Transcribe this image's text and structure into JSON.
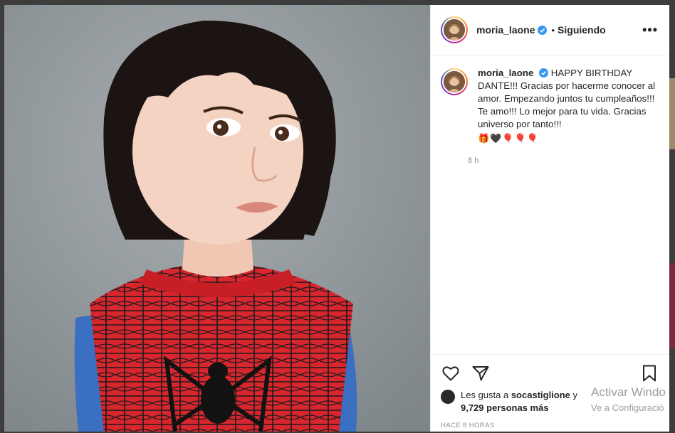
{
  "post": {
    "username": "moria_laone",
    "follow_status": "Siguiendo",
    "more_label": "•••",
    "caption": "HAPPY BIRTHDAY DANTE!!! Gracias por hacerme conocer al amor. Empezando juntos tu cumpleaños!!! Te amo!!! Lo mejor para tu vida. Gracias universo por tanto!!!",
    "caption_emoji": "🎁🖤🎈🎈🎈",
    "caption_time": "8 h",
    "likes_prefix": "Les gusta a ",
    "likes_user": "socastiglione",
    "likes_suffix": " y",
    "likes_count": "9,729 personas más",
    "posted_ago": "HACE 8 HORAS",
    "photo_icon": "photo-of-child-in-spiderman-shirt"
  },
  "icons": {
    "like": "heart-icon",
    "share": "share-icon",
    "save": "bookmark-icon",
    "verified": "verified-badge-icon"
  },
  "watermark": {
    "line1": "Activar Windo",
    "line2": "Ve a Configuració"
  },
  "colors": {
    "verified": "#3897f0",
    "secondary_text": "#8e8e8e",
    "shirt_red": "#d8262e",
    "shirt_blue": "#3a6fc2"
  }
}
